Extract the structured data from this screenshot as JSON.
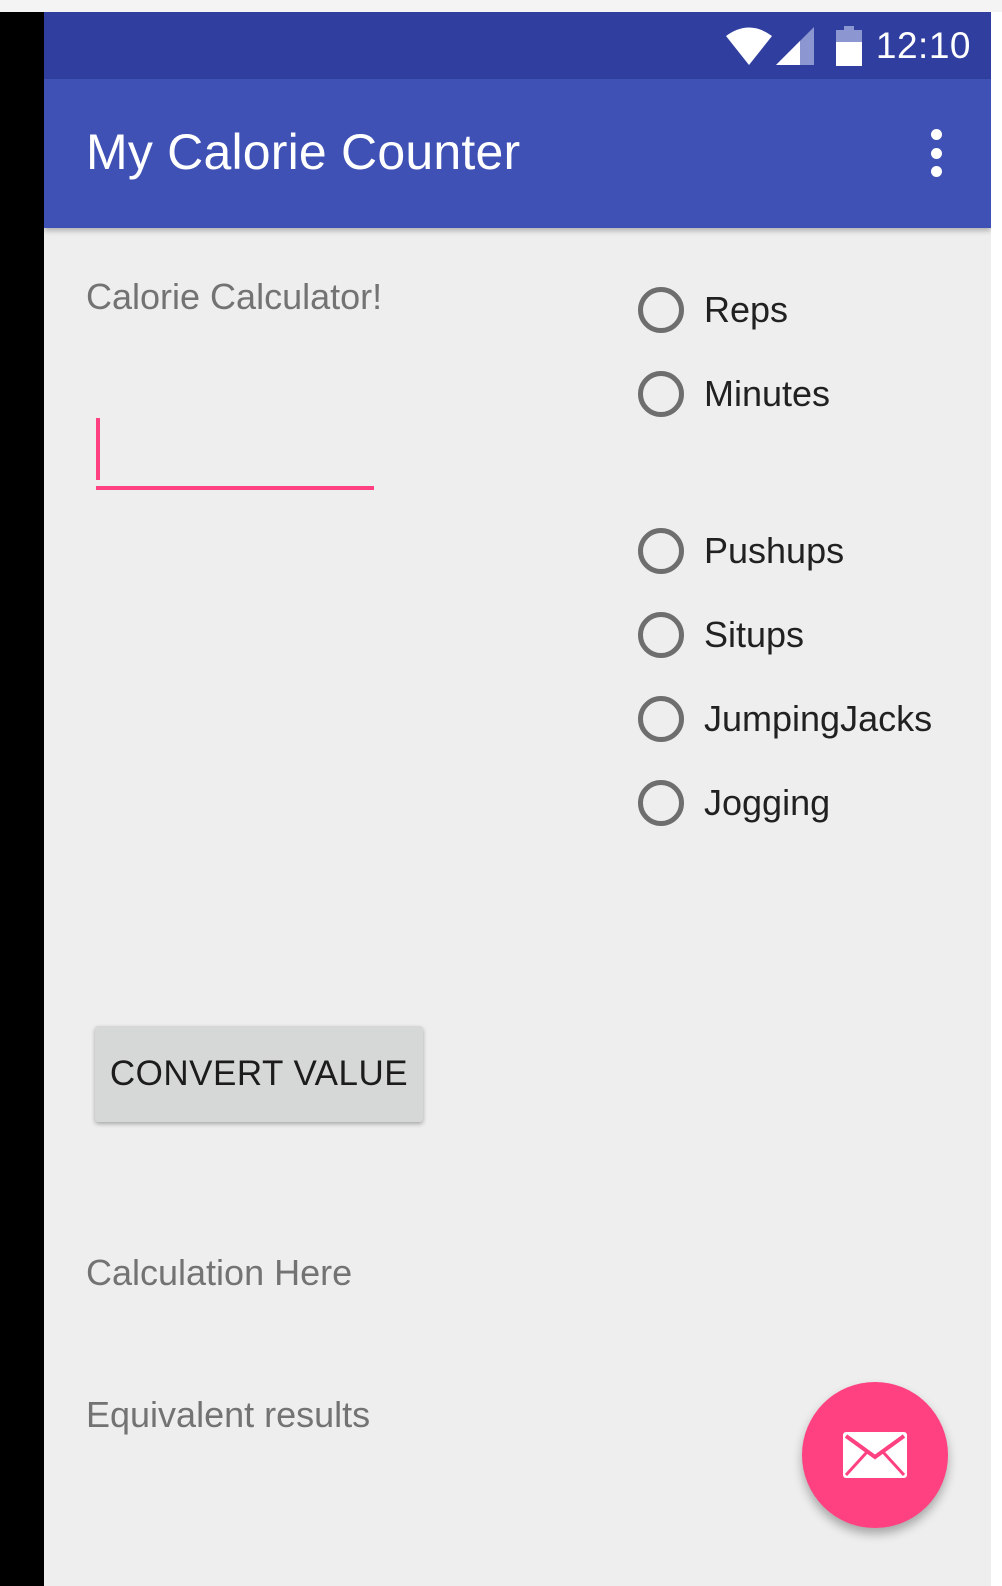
{
  "status_bar": {
    "time": "12:10",
    "icons": [
      "wifi-icon",
      "cell-signal-icon",
      "battery-icon"
    ]
  },
  "app_bar": {
    "title": "My Calorie Counter",
    "menu_icon": "overflow-menu-icon"
  },
  "content": {
    "heading": "Calorie Calculator!",
    "input": {
      "value": "",
      "placeholder": ""
    },
    "unit_options": [
      {
        "label": "Reps",
        "selected": false
      },
      {
        "label": "Minutes",
        "selected": false
      }
    ],
    "exercise_options": [
      {
        "label": "Pushups",
        "selected": false
      },
      {
        "label": "Situps",
        "selected": false
      },
      {
        "label": "JumpingJacks",
        "selected": false
      },
      {
        "label": "Jogging",
        "selected": false
      }
    ],
    "convert_button": "CONVERT VALUE",
    "calculation_text": "Calculation Here",
    "equivalent_text": "Equivalent results"
  },
  "fab": {
    "icon": "email-icon"
  },
  "colors": {
    "primary": "#3f51b5",
    "primary_dark": "#303f9f",
    "accent": "#ff4081",
    "background": "#eeeeee",
    "button": "#d6d7d7"
  }
}
